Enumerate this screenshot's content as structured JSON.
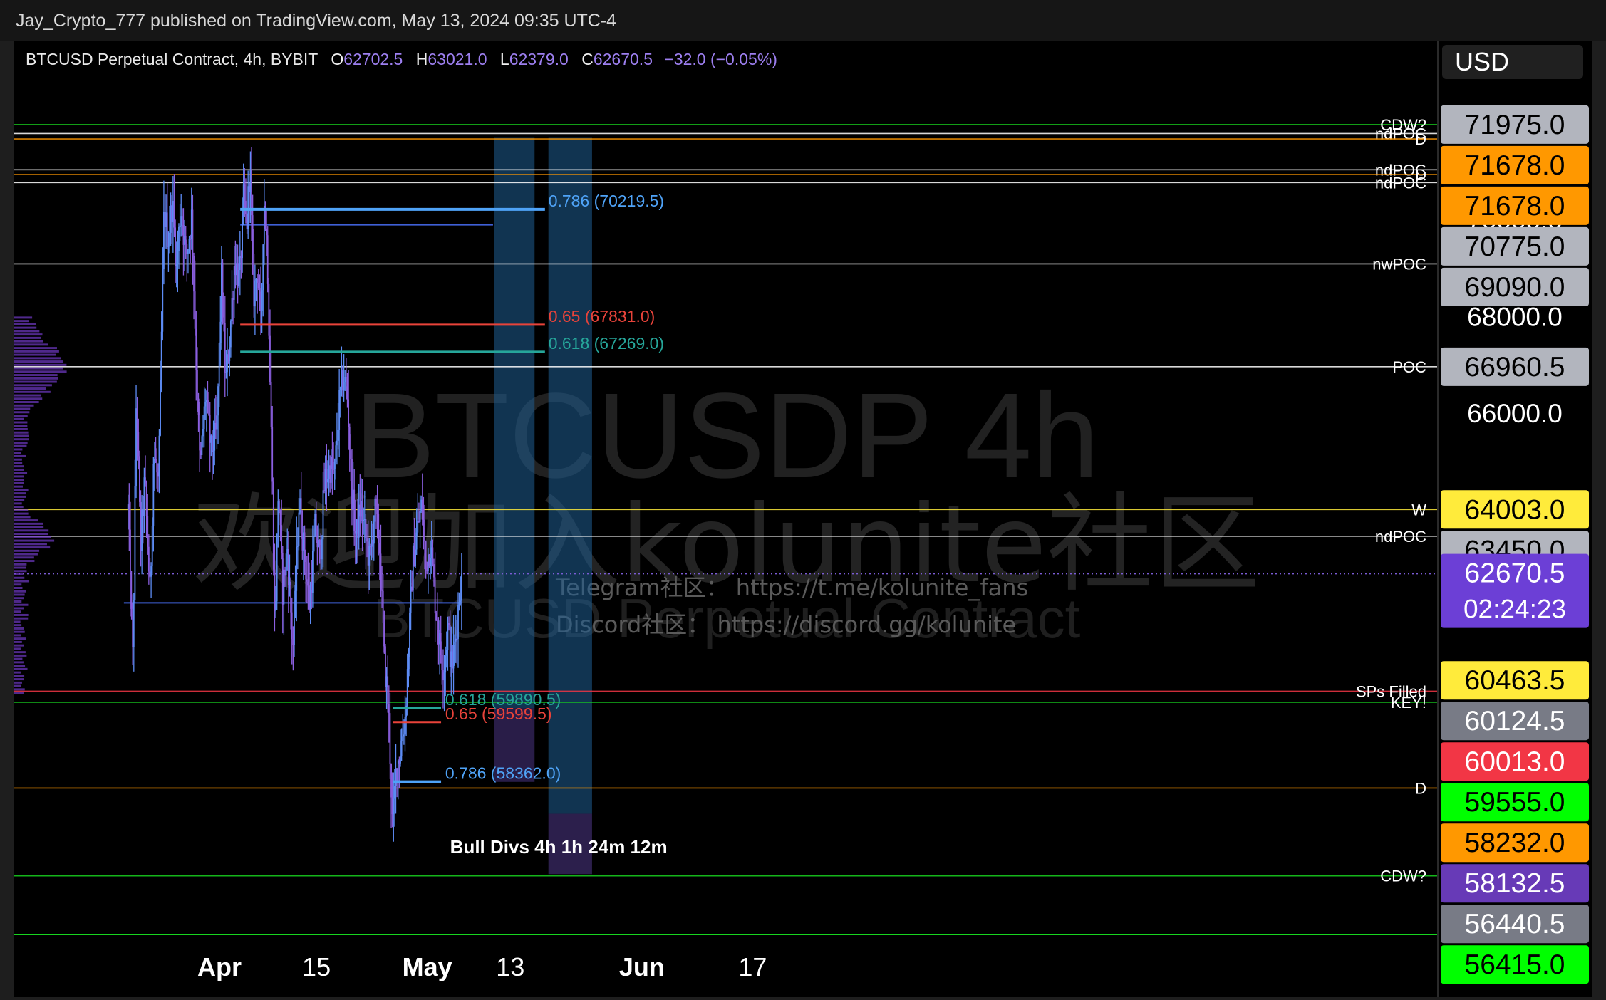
{
  "header": {
    "publisher_line": "Jay_Crypto_777 published on TradingView.com, May 13, 2024 09:35 UTC-4"
  },
  "legend": {
    "symbol": "BTCUSD Perpetual Contract, 4h, BYBIT",
    "o_label": "O",
    "o_value": "62702.5",
    "h_label": "H",
    "h_value": "63021.0",
    "l_label": "L",
    "l_value": "62379.0",
    "c_label": "C",
    "c_value": "62670.5",
    "change": "−32.0 (−0.05%)"
  },
  "currency_button": "USD",
  "watermark": {
    "big": "BTCUSDP 4h",
    "chinese": "欢迎加入kolunite社区",
    "subtitle": "BTCUSD Perpetual Contract",
    "telegram": "Telegram社区： https://t.me/kolunite_fans",
    "discord": "Discord社区： https://discord.gg/kolunite"
  },
  "chart_data": {
    "type": "candlestick",
    "symbol": "BTCUSD Perpetual Contract",
    "timeframe": "4h",
    "exchange": "BYBIT",
    "x_ticks": [
      {
        "label": "Apr",
        "day": 0,
        "bold": true
      },
      {
        "label": "15",
        "day": 14,
        "bold": false
      },
      {
        "label": "May",
        "day": 30,
        "bold": true
      },
      {
        "label": "13",
        "day": 42,
        "bold": false
      },
      {
        "label": "Jun",
        "day": 61,
        "bold": true
      },
      {
        "label": "17",
        "day": 77,
        "bold": false
      }
    ],
    "y_ticks": [
      "70000.0",
      "68000.0",
      "66000.0"
    ],
    "ylim": [
      55200,
      73700
    ],
    "last_price": 62670.5,
    "countdown": "02:24:23",
    "candle_anchors": [
      [
        -13.2,
        64000
      ],
      [
        -12.5,
        60800
      ],
      [
        -12.0,
        66500
      ],
      [
        -11.4,
        63200
      ],
      [
        -10.8,
        64600
      ],
      [
        -10.0,
        62200
      ],
      [
        -9.5,
        65200
      ],
      [
        -8.8,
        64500
      ],
      [
        -8.0,
        70200
      ],
      [
        -7.4,
        69600
      ],
      [
        -6.8,
        70400
      ],
      [
        -6.2,
        69000
      ],
      [
        -5.6,
        70300
      ],
      [
        -4.8,
        69200
      ],
      [
        -4.0,
        70100
      ],
      [
        -3.4,
        67200
      ],
      [
        -2.8,
        64800
      ],
      [
        -2.0,
        66400
      ],
      [
        -1.2,
        65200
      ],
      [
        -0.4,
        65600
      ],
      [
        0.3,
        68800
      ],
      [
        0.9,
        66600
      ],
      [
        1.5,
        67600
      ],
      [
        2.2,
        69200
      ],
      [
        2.9,
        68700
      ],
      [
        3.5,
        70500
      ],
      [
        3.9,
        69800
      ],
      [
        4.4,
        71200
      ],
      [
        4.9,
        68400
      ],
      [
        5.5,
        69000
      ],
      [
        6.0,
        67700
      ],
      [
        6.4,
        70500
      ],
      [
        6.9,
        69400
      ],
      [
        7.5,
        65500
      ],
      [
        8.0,
        61500
      ],
      [
        8.5,
        64500
      ],
      [
        9.1,
        62300
      ],
      [
        9.8,
        63200
      ],
      [
        10.6,
        61100
      ],
      [
        11.5,
        64200
      ],
      [
        12.3,
        63000
      ],
      [
        13.0,
        62000
      ],
      [
        13.8,
        63600
      ],
      [
        14.5,
        63000
      ],
      [
        15.2,
        64600
      ],
      [
        16.0,
        64900
      ],
      [
        16.6,
        64700
      ],
      [
        17.3,
        66200
      ],
      [
        17.9,
        66800
      ],
      [
        18.5,
        66300
      ],
      [
        19.1,
        64400
      ],
      [
        19.7,
        63400
      ],
      [
        20.4,
        64100
      ],
      [
        21.0,
        63500
      ],
      [
        21.7,
        62900
      ],
      [
        22.4,
        64000
      ],
      [
        23.1,
        63300
      ],
      [
        23.8,
        60900
      ],
      [
        24.4,
        59900
      ],
      [
        25.0,
        57400
      ],
      [
        25.5,
        58600
      ],
      [
        26.2,
        59100
      ],
      [
        26.8,
        59700
      ],
      [
        27.3,
        61100
      ],
      [
        27.9,
        62900
      ],
      [
        28.6,
        63600
      ],
      [
        29.2,
        64100
      ],
      [
        29.8,
        62900
      ],
      [
        30.5,
        63300
      ],
      [
        31.2,
        62000
      ],
      [
        31.8,
        61200
      ],
      [
        32.4,
        60700
      ],
      [
        33.0,
        61600
      ],
      [
        33.5,
        60700
      ],
      [
        34.1,
        61300
      ],
      [
        34.6,
        62200
      ],
      [
        35.0,
        62670
      ]
    ],
    "volume_profile_peak_price": 66960,
    "horizontal_levels": [
      {
        "label": "CDW?",
        "price": 71975.0,
        "color": "#17d51f",
        "badge": "71975.0",
        "badge_bg": "#b2b5be",
        "badge_fg": "#000000"
      },
      {
        "label": "ndPOC",
        "price": 71790.0,
        "color": "#ffffff",
        "badge": "",
        "badge_bg": "",
        "badge_fg": ""
      },
      {
        "label": "D",
        "price": 71678.0,
        "color": "#ff9800",
        "badge": "71678.0",
        "badge_bg": "#ff9800",
        "badge_fg": "#000000"
      },
      {
        "label": "ndPOC",
        "price": 71040.0,
        "color": "#ffffff",
        "badge": "",
        "badge_bg": "",
        "badge_fg": ""
      },
      {
        "label": "D",
        "price": 70940.0,
        "color": "#ff9800",
        "badge": "71678.0",
        "badge_bg": "#ff9800",
        "badge_fg": "#000000"
      },
      {
        "label": "ndPOC",
        "price": 70775.0,
        "color": "#ffffff",
        "badge": "70775.0",
        "badge_bg": "#b2b5be",
        "badge_fg": "#000000"
      },
      {
        "label": "nwPOC",
        "price": 69090.0,
        "color": "#ffffff",
        "badge": "69090.0",
        "badge_bg": "#b2b5be",
        "badge_fg": "#000000"
      },
      {
        "label": "POC",
        "price": 66960.5,
        "color": "#ffffff",
        "badge": "66960.5",
        "badge_bg": "#b2b5be",
        "badge_fg": "#000000"
      },
      {
        "label": "W",
        "price": 64003.0,
        "color": "#ffeb3b",
        "badge": "64003.0",
        "badge_bg": "#ffeb3b",
        "badge_fg": "#000000"
      },
      {
        "label": "ndPOC",
        "price": 63450.0,
        "color": "#ffffff",
        "badge": "63450.0",
        "badge_bg": "#b2b5be",
        "badge_fg": "#000000"
      },
      {
        "label": "SPs Filled",
        "price": 60240.0,
        "color": "#f23645",
        "badge": "60463.5",
        "badge_bg": "#ffeb3b",
        "badge_fg": "#000000"
      },
      {
        "label": "KEY!",
        "price": 60010.0,
        "color": "#17d51f",
        "badge": "60124.5",
        "badge_bg": "#787b86",
        "badge_fg": "#ffffff"
      },
      {
        "label": "D",
        "price": 58232.0,
        "color": "#ff9800",
        "badge": "60013.0",
        "badge_bg": "#f23645",
        "badge_fg": "#ffffff"
      },
      {
        "label": "CDW?",
        "price": 56415.0,
        "color": "#17d51f",
        "badge": "56415.0",
        "badge_bg": "#00ff00",
        "badge_fg": "#000000"
      }
    ],
    "price_badges": [
      {
        "value": "71975.0",
        "bg": "#b2b5be",
        "fg": "#000000",
        "price": 71975.0
      },
      {
        "value": "71678.0",
        "bg": "#ff9800",
        "fg": "#000000",
        "price": 71678.0
      },
      {
        "value": "71678.0",
        "bg": "#ff9800",
        "fg": "#000000",
        "price": 70940.0
      },
      {
        "value": "70775.0",
        "bg": "#b2b5be",
        "fg": "#000000",
        "price": 70775.0
      },
      {
        "value": "69090.0",
        "bg": "#b2b5be",
        "fg": "#000000",
        "price": 69090.0
      },
      {
        "value": "66960.5",
        "bg": "#b2b5be",
        "fg": "#000000",
        "price": 66960.5
      },
      {
        "value": "64003.0",
        "bg": "#ffeb3b",
        "fg": "#000000",
        "price": 64003.0
      },
      {
        "value": "63450.0",
        "bg": "#b2b5be",
        "fg": "#000000",
        "price": 63450.0
      },
      {
        "value": "60463.5",
        "bg": "#ffeb3b",
        "fg": "#000000",
        "price": 60463.5
      },
      {
        "value": "60124.5",
        "bg": "#787b86",
        "fg": "#ffffff",
        "price": 60124.5
      },
      {
        "value": "60013.0",
        "bg": "#f23645",
        "fg": "#ffffff",
        "price": 60013.0
      },
      {
        "value": "59555.0",
        "bg": "#00ff00",
        "fg": "#000000",
        "price": 59555.0
      },
      {
        "value": "58232.0",
        "bg": "#ff9800",
        "fg": "#000000",
        "price": 58232.0
      },
      {
        "value": "58132.5",
        "bg": "#673ab7",
        "fg": "#ffffff",
        "price": 58132.5
      },
      {
        "value": "56440.5",
        "bg": "#787b86",
        "fg": "#ffffff",
        "price": 56440.5
      },
      {
        "value": "56415.0",
        "bg": "#00ff00",
        "fg": "#000000",
        "price": 56415.0
      }
    ],
    "blue_lines": [
      {
        "day_start": 3.0,
        "day_end": 39.5,
        "price": 69900
      },
      {
        "day_start": -13.8,
        "day_end": 35.0,
        "price": 62070
      }
    ],
    "fib_levels": [
      {
        "text": "0.786 (70219.5)",
        "price": 70219.5,
        "color": "#4fa3f7",
        "day_start": 3.0,
        "day_end": 47.0,
        "label_day": 47.5,
        "width": 4
      },
      {
        "text": "0.65 (67831.0)",
        "price": 67831.0,
        "color": "#e8433a",
        "day_start": 3.0,
        "day_end": 47.0,
        "label_day": 47.5,
        "width": 3
      },
      {
        "text": "0.618 (67269.0)",
        "price": 67269.0,
        "color": "#26a69a",
        "day_start": 3.0,
        "day_end": 47.0,
        "label_day": 47.5,
        "width": 3
      },
      {
        "text": "0.618 (59890.5)",
        "price": 59890.5,
        "color": "#26a69a",
        "day_start": 25.0,
        "day_end": 32.0,
        "label_day": 32.6,
        "width": 3
      },
      {
        "text": "0.65 (59599.5)",
        "price": 59599.5,
        "color": "#e8433a",
        "day_start": 25.0,
        "day_end": 32.0,
        "label_day": 32.6,
        "width": 3
      },
      {
        "text": "0.786 (58362.0)",
        "price": 58362.0,
        "color": "#4fa3f7",
        "day_start": 25.0,
        "day_end": 32.0,
        "label_day": 32.6,
        "width": 4
      }
    ],
    "zones": [
      {
        "day_start": 39.7,
        "day_end": 45.5,
        "price_top": 71700,
        "price_bottom": 59890,
        "color": "#1f5f93",
        "opacity": 0.55
      },
      {
        "day_start": 39.7,
        "day_end": 45.5,
        "price_top": 59890,
        "price_bottom": 58360,
        "color": "#3b2a66",
        "opacity": 0.7
      },
      {
        "day_start": 47.5,
        "day_end": 53.8,
        "price_top": 71700,
        "price_bottom": 57700,
        "color": "#1f5f93",
        "opacity": 0.55
      },
      {
        "day_start": 47.5,
        "day_end": 53.8,
        "price_top": 57700,
        "price_bottom": 56450,
        "color": "#3b2a66",
        "opacity": 0.75
      }
    ],
    "annotation": {
      "text": "Bull Divs 4h 1h 24m 12m",
      "day": 33.3,
      "price": 57000
    }
  }
}
